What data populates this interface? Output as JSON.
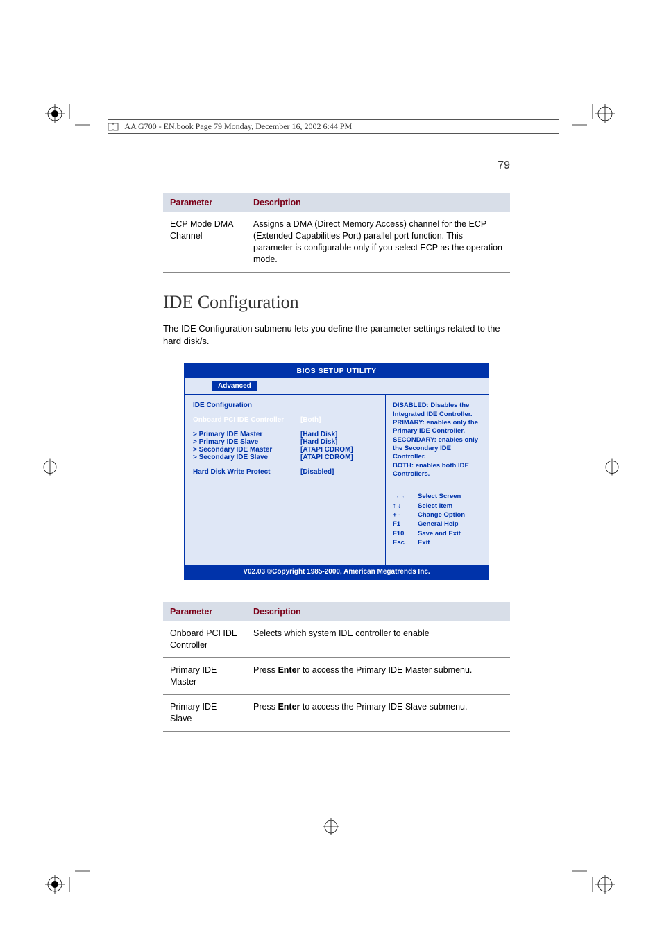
{
  "book_meta": "AA G700 - EN.book  Page 79  Monday, December 16, 2002  6:44 PM",
  "page_number": "79",
  "table1": {
    "headers": {
      "param": "Parameter",
      "desc": "Description"
    },
    "rows": [
      {
        "param": "ECP Mode DMA Channel",
        "desc": "Assigns a DMA (Direct Memory Access) channel for the ECP (Extended Capabilities Port) parallel port function. This parameter is configurable only if you select ECP as the operation mode."
      }
    ]
  },
  "section_heading": "IDE Configuration",
  "intro": "The IDE Configuration submenu lets you define the parameter settings related to the hard disk/s.",
  "bios": {
    "title": "BIOS SETUP UTILITY",
    "active_tab": "Advanced",
    "left_heading": "IDE Configuration",
    "highlight_label": "Onboard PCI IDE Controller",
    "highlight_value": "[Both]",
    "items": [
      {
        "label": "> Primary IDE Master",
        "value": "[Hard Disk]"
      },
      {
        "label": "> Primary IDE Slave",
        "value": "[Hard Disk]"
      },
      {
        "label": "> Secondary IDE Master",
        "value": "[ATAPI CDROM]"
      },
      {
        "label": "> Secondary IDE Slave",
        "value": "[ATAPI CDROM]"
      }
    ],
    "write_protect": {
      "label": "Hard Disk Write Protect",
      "value": "[Disabled]"
    },
    "help_text_1": "DISABLED: Disables the Integrated IDE Controller.",
    "help_text_2": "PRIMARY: enables only the Primary IDE Controller.",
    "help_text_3": "SECONDARY: enables only the Secondary IDE Controller.",
    "help_text_4": "BOTH: enables both IDE Controllers.",
    "keys": [
      {
        "k": "→ ←",
        "t": "Select Screen"
      },
      {
        "k": "↑ ↓",
        "t": "Select Item"
      },
      {
        "k": "+ -",
        "t": "Change Option"
      },
      {
        "k": "F1",
        "t": "General Help"
      },
      {
        "k": "F10",
        "t": "Save and Exit"
      },
      {
        "k": "Esc",
        "t": "Exit"
      }
    ],
    "footer": "V02.03 ©Copyright 1985-2000, American Megatrends Inc."
  },
  "table2": {
    "headers": {
      "param": "Parameter",
      "desc": "Description"
    },
    "rows": [
      {
        "param": "Onboard PCI IDE Controller",
        "desc_plain": "Selects which system IDE controller to enable"
      },
      {
        "param": "Primary IDE Master",
        "desc_pre": "Press ",
        "desc_bold": "Enter",
        "desc_post": " to access the Primary IDE Master submenu."
      },
      {
        "param": "Primary IDE Slave",
        "desc_pre": "Press ",
        "desc_bold": "Enter",
        "desc_post": " to access the Primary IDE Slave submenu."
      }
    ]
  }
}
